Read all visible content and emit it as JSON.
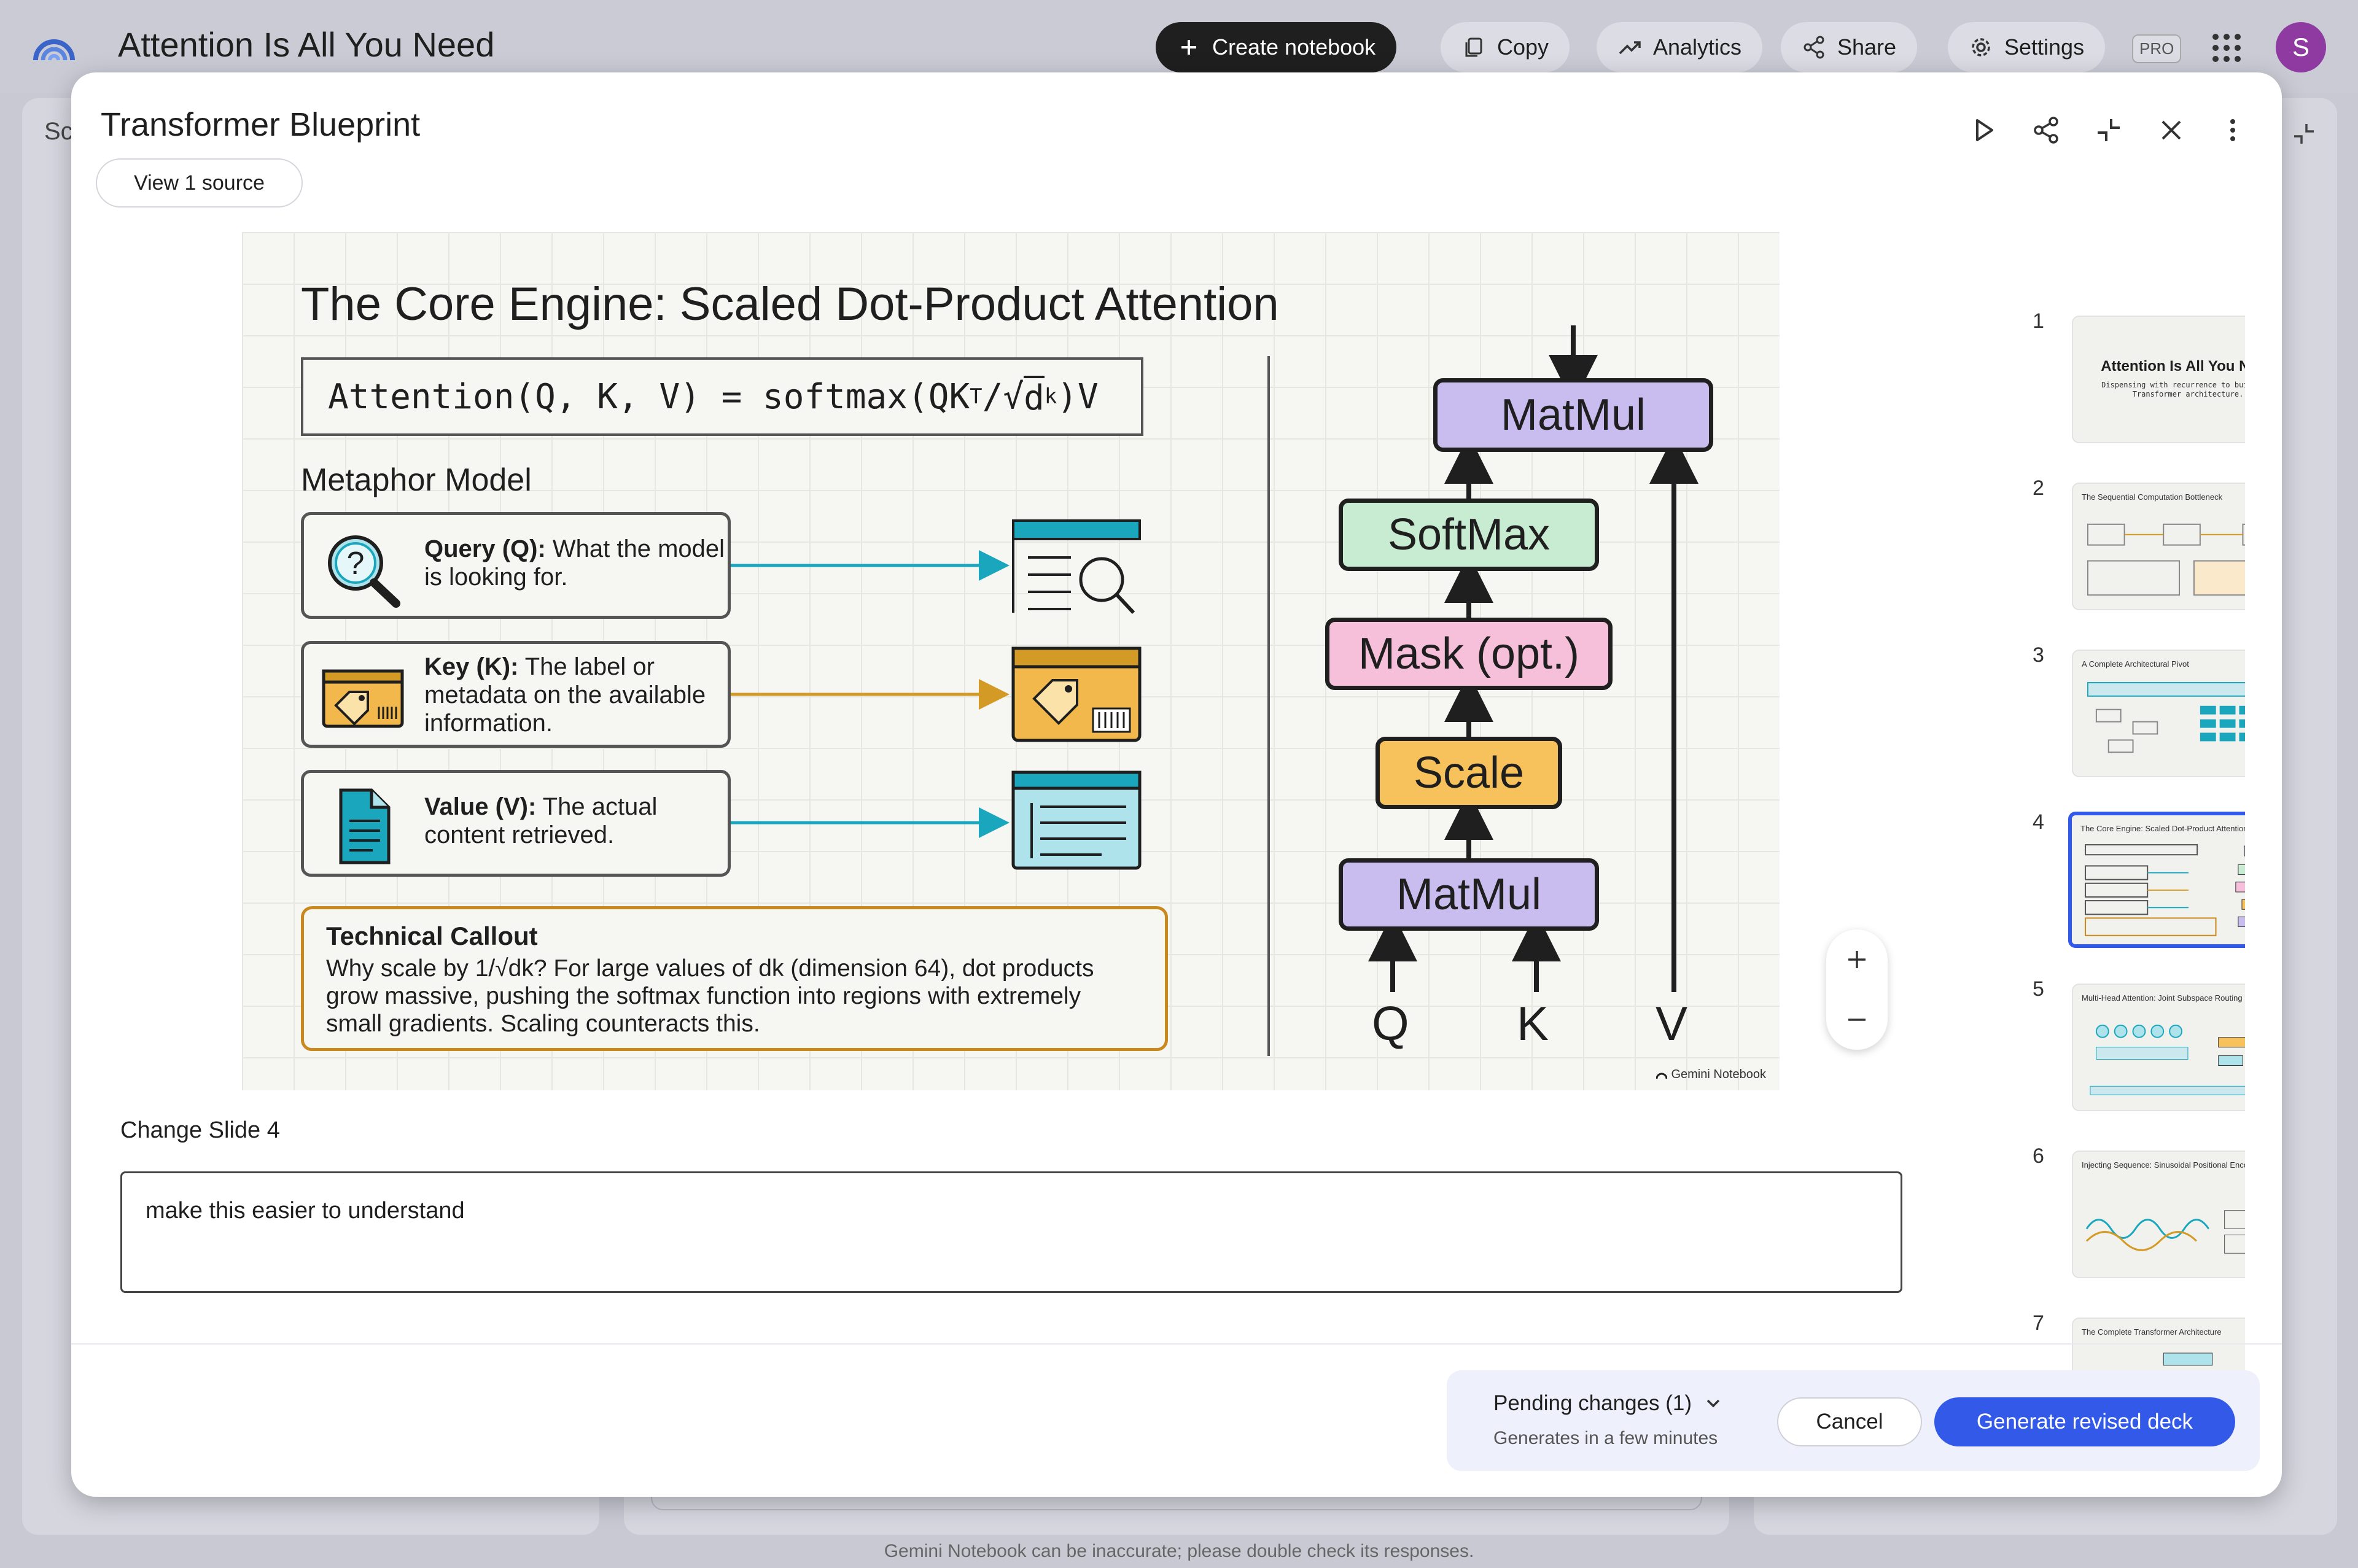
{
  "app": {
    "title": "Attention Is All You Need",
    "buttons": {
      "create_notebook": "Create notebook",
      "copy": "Copy",
      "analytics": "Analytics",
      "share": "Share",
      "settings": "Settings"
    },
    "pro_badge": "PRO",
    "avatar_initial": "S",
    "left_panel_label": "Sc",
    "disclaimer": "Gemini Notebook can be inaccurate; please double check its responses."
  },
  "modal": {
    "title": "Transformer Blueprint",
    "view_source": "View 1 source",
    "header_icons": [
      "play-icon",
      "share-icon",
      "collapse-icon",
      "close-icon",
      "more-vert-icon"
    ]
  },
  "slide": {
    "title": "The Core Engine: Scaled Dot-Product Attention",
    "formula_prefix": "Attention(Q, K, V) = softmax(QK",
    "formula_sup": "T",
    "formula_mid": "/√",
    "formula_dk": "d",
    "formula_sub": "k",
    "formula_suffix": ")V",
    "metaphor_heading": "Metaphor Model",
    "cards": [
      {
        "label": "Query (Q):",
        "text": " What the model is looking for.",
        "icon": "search-question-icon",
        "target_icon": "document-search-icon",
        "color": "#1aa7be"
      },
      {
        "label": "Key (K):",
        "text": " The label or metadata on the available information.",
        "icon": "tag-card-icon",
        "target_icon": "tag-barcode-icon",
        "color": "#d39a25"
      },
      {
        "label": "Value (V):",
        "text": " The actual content retrieved.",
        "icon": "document-icon",
        "target_icon": "content-window-icon",
        "color": "#1aa7be"
      }
    ],
    "callout": {
      "title": "Technical Callout",
      "body": "Why scale by 1/√dk? For large values of dk (dimension 64), dot products grow massive, pushing the softmax function into regions with extremely small gradients. Scaling counteracts this."
    },
    "blocks": {
      "matmul_top": "MatMul",
      "softmax": "SoftMax",
      "mask": "Mask (opt.)",
      "scale": "Scale",
      "matmul_bottom": "MatMul"
    },
    "block_colors": {
      "matmul": "#c9bdf0",
      "softmax": "#c8ecd2",
      "mask": "#f6c0db",
      "scale": "#f7c25c"
    },
    "inputs": [
      "Q",
      "K",
      "V"
    ],
    "watermark": "Gemini Notebook"
  },
  "zoom": {
    "in": "+",
    "out": "−"
  },
  "thumbnails": [
    {
      "num": "1",
      "title": "Attention Is All You Need",
      "sub": "Dispensing with recurrence to build the Transformer architecture."
    },
    {
      "num": "2",
      "title": "The Sequential Computation Bottleneck",
      "sub": ""
    },
    {
      "num": "3",
      "title": "A Complete Architectural Pivot",
      "sub": ""
    },
    {
      "num": "4",
      "title": "The Core Engine: Scaled Dot-Product Attention",
      "sub": ""
    },
    {
      "num": "5",
      "title": "Multi-Head Attention: Joint Subspace Routing",
      "sub": ""
    },
    {
      "num": "6",
      "title": "Injecting Sequence: Sinusoidal Positional Encoding",
      "sub": ""
    },
    {
      "num": "7",
      "title": "The Complete Transformer Architecture",
      "sub": ""
    }
  ],
  "selected_thumbnail": "4",
  "change": {
    "label": "Change Slide 4",
    "value": "make this easier to understand"
  },
  "footer": {
    "pending_title": "Pending changes (1)",
    "pending_sub": "Generates in a few minutes",
    "cancel": "Cancel",
    "generate": "Generate revised deck"
  },
  "colors": {
    "accent": "#3259e8",
    "avatar": "#8e3aa0"
  }
}
